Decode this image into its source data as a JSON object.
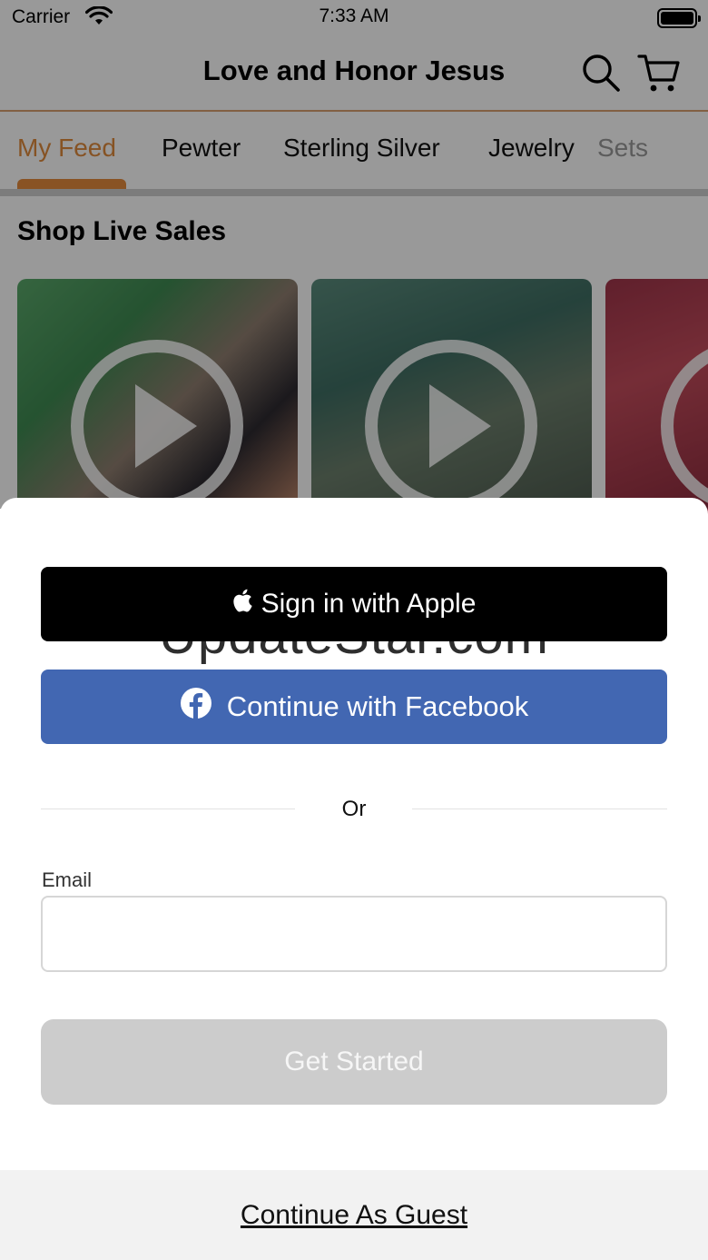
{
  "status_bar": {
    "carrier": "Carrier",
    "time": "7:33 AM",
    "wifi_icon": "wifi-icon",
    "battery_icon": "battery-icon"
  },
  "header": {
    "title": "Love and Honor Jesus",
    "search_icon": "search-icon",
    "cart_icon": "cart-icon"
  },
  "tabs": [
    {
      "label": "My Feed",
      "active": true
    },
    {
      "label": "Pewter",
      "active": false
    },
    {
      "label": "Sterling Silver",
      "active": false
    },
    {
      "label": "Jewelry",
      "active": false
    },
    {
      "label": "Sets",
      "active": false
    }
  ],
  "live_sales": {
    "title": "Shop Live Sales",
    "cards": [
      {
        "icon": "play-icon"
      },
      {
        "icon": "play-icon"
      },
      {
        "icon": "play-icon"
      }
    ]
  },
  "sheet": {
    "apple_button": "Sign in with Apple",
    "facebook_button": "Continue with Facebook",
    "divider": "Or",
    "email_label": "Email",
    "email_value": "",
    "email_placeholder": "",
    "get_started": "Get Started",
    "guest_link": "Continue As Guest",
    "watermark": "UpdateStar.com"
  },
  "colors": {
    "accent": "#e58a3c",
    "facebook": "#4267b2",
    "apple": "#000000",
    "disabled_button": "#cccccc"
  }
}
